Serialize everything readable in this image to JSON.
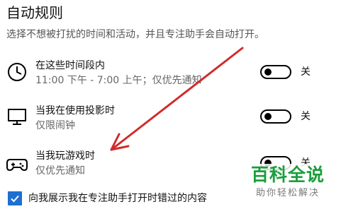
{
  "section": {
    "title": "自动规则",
    "description": "选择不想被打扰的时间和活动，并且专注助手会自动打开。"
  },
  "rules": [
    {
      "icon": "clock-icon",
      "title": "在这些时间段内",
      "subtitle": "11:00 下午 - 7:00 上午；仅优先通知",
      "toggle_state": "关"
    },
    {
      "icon": "monitor-icon",
      "title": "当我在使用投影时",
      "subtitle": "仅限闹钟",
      "toggle_state": "关"
    },
    {
      "icon": "gamepad-icon",
      "title": "当我玩游戏时",
      "subtitle": "仅优先通知",
      "toggle_state": "关"
    }
  ],
  "checkbox": {
    "checked": true,
    "label": "向我展示我在专注助手打开时错过的内容"
  },
  "watermark": {
    "main": "百科全说",
    "sub": "助你轻松解决"
  },
  "colors": {
    "accent": "#1f6fd2",
    "annotation_arrow": "#d22a2a",
    "watermark_green": "#1a9e3b"
  }
}
